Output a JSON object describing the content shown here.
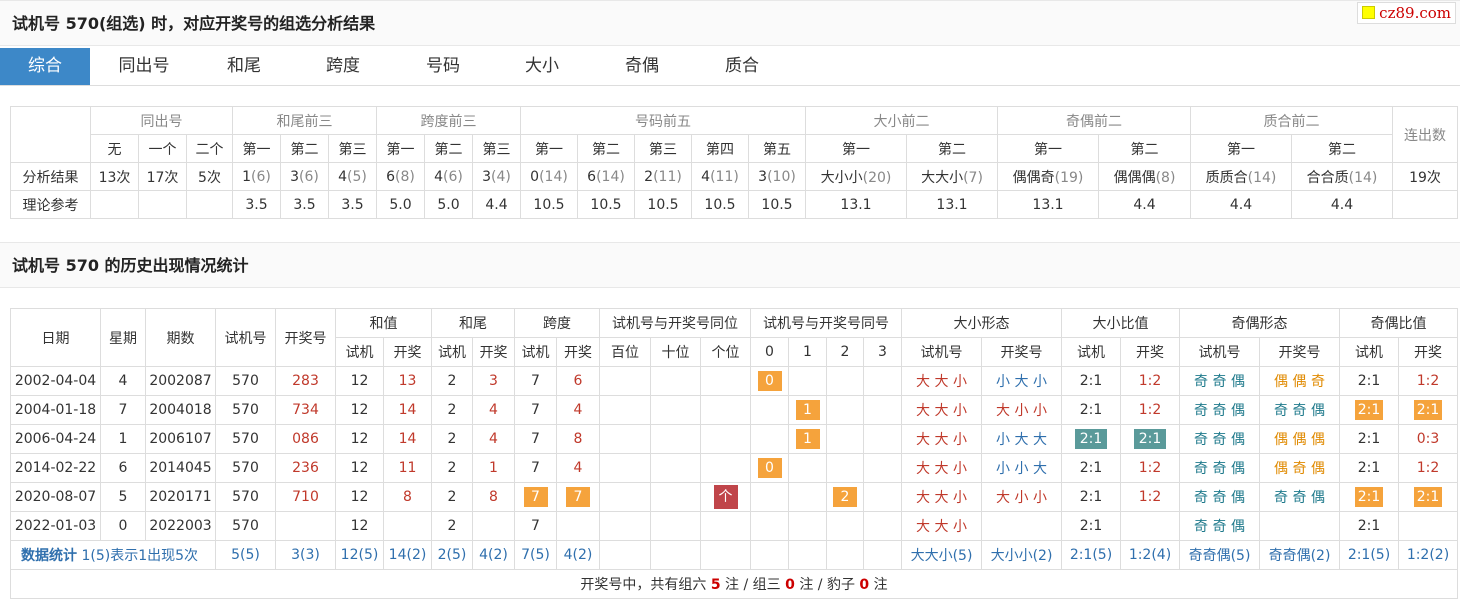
{
  "title1": "试机号 570(组选) 时，对应开奖号的组选分析结果",
  "logo": "cz89.com",
  "tabs": [
    "综合",
    "同出号",
    "和尾",
    "跨度",
    "号码",
    "大小",
    "奇偶",
    "质合"
  ],
  "title2": "试机号 570 的历史出现情况统计",
  "summary": {
    "groups": [
      "同出号",
      "和尾前三",
      "跨度前三",
      "号码前五",
      "大小前二",
      "奇偶前二",
      "质合前二",
      "连出数"
    ],
    "sub_tongchu": [
      "无",
      "一个",
      "二个"
    ],
    "sub3": [
      "第一",
      "第二",
      "第三"
    ],
    "sub5": [
      "第一",
      "第二",
      "第三",
      "第四",
      "第五"
    ],
    "sub2": [
      "第一",
      "第二"
    ],
    "row1_label": "分析结果",
    "row2_label": "理论参考",
    "tongchu_res": [
      "13次",
      "17次",
      "5次"
    ],
    "hewei_res": [
      [
        "1",
        "(6)"
      ],
      [
        "3",
        "(6)"
      ],
      [
        "4",
        "(5)"
      ]
    ],
    "kuadu_res": [
      [
        "6",
        "(8)"
      ],
      [
        "4",
        "(6)"
      ],
      [
        "3",
        "(4)"
      ]
    ],
    "haoma_res": [
      [
        "0",
        "(14)"
      ],
      [
        "6",
        "(14)"
      ],
      [
        "2",
        "(11)"
      ],
      [
        "4",
        "(11)"
      ],
      [
        "3",
        "(10)"
      ]
    ],
    "daxiao_res": [
      [
        "大小小",
        "(20)"
      ],
      [
        "大大小",
        "(7)"
      ]
    ],
    "jiou_res": [
      [
        "偶偶奇",
        "(19)"
      ],
      [
        "偶偶偶",
        "(8)"
      ]
    ],
    "zhihe_res": [
      [
        "质质合",
        "(14)"
      ],
      [
        "合合质",
        "(14)"
      ]
    ],
    "lianchu_res": "19次",
    "ref": [
      "3.5",
      "3.5",
      "3.5",
      "5.0",
      "5.0",
      "4.4",
      "10.5",
      "10.5",
      "10.5",
      "10.5",
      "10.5",
      "13.1",
      "13.1",
      "13.1",
      "4.4",
      "4.4",
      "4.4"
    ]
  },
  "history": {
    "headers": {
      "date": "日期",
      "week": "星期",
      "issue": "期数",
      "trial": "试机号",
      "draw": "开奖号",
      "hezhi": "和值",
      "hewei": "和尾",
      "kuadu": "跨度",
      "tongwei": "试机号与开奖号同位",
      "tonghao": "试机号与开奖号同号",
      "dxxt": "大小形态",
      "dxbz": "大小比值",
      "joxt": "奇偶形态",
      "jobz": "奇偶比值",
      "shiji": "试机",
      "kaijiang": "开奖",
      "shijihao": "试机号",
      "kaijianghao": "开奖号",
      "bai": "百位",
      "shi": "十位",
      "ge": "个位",
      "n0": "0",
      "n1": "1",
      "n2": "2",
      "n3": "3"
    },
    "rows": [
      {
        "date": "2002-04-04",
        "week": "4",
        "issue": "2002087",
        "trial": "570",
        "draw": "283",
        "hz_s": "12",
        "hz_k": "13",
        "hw_s": "2",
        "hw_k": "3",
        "kd_s": "7",
        "kd_k": "6",
        "kd_s_hl": false,
        "kd_k_hl": false,
        "tw": [
          "",
          "",
          ""
        ],
        "th": [
          "0",
          "",
          "",
          ""
        ],
        "dx_s": "大 大 小",
        "dx_k": "小 大 小",
        "dx_k_col": "blue",
        "dxb_s": "2:1",
        "dxb_k": "1:2",
        "dxb_hl": false,
        "jo_s": "奇 奇 偶",
        "jo_k": "偶 偶 奇",
        "jo_k_col": "orange",
        "job_s": "2:1",
        "job_k": "1:2",
        "job_hl": false
      },
      {
        "date": "2004-01-18",
        "week": "7",
        "issue": "2004018",
        "trial": "570",
        "draw": "734",
        "hz_s": "12",
        "hz_k": "14",
        "hw_s": "2",
        "hw_k": "4",
        "kd_s": "7",
        "kd_k": "4",
        "kd_s_hl": false,
        "kd_k_hl": false,
        "tw": [
          "",
          "",
          ""
        ],
        "th": [
          "",
          "1",
          "",
          ""
        ],
        "dx_s": "大 大 小",
        "dx_k": "大 小 小",
        "dx_k_col": "red",
        "dxb_s": "2:1",
        "dxb_k": "1:2",
        "dxb_hl": false,
        "jo_s": "奇 奇 偶",
        "jo_k": "奇 奇 偶",
        "jo_k_col": "teal",
        "job_s": "2:1",
        "job_k": "2:1",
        "job_hl": true
      },
      {
        "date": "2006-04-24",
        "week": "1",
        "issue": "2006107",
        "trial": "570",
        "draw": "086",
        "hz_s": "12",
        "hz_k": "14",
        "hw_s": "2",
        "hw_k": "4",
        "kd_s": "7",
        "kd_k": "8",
        "kd_s_hl": false,
        "kd_k_hl": false,
        "tw": [
          "",
          "",
          ""
        ],
        "th": [
          "",
          "1",
          "",
          ""
        ],
        "dx_s": "大 大 小",
        "dx_k": "小 大 大",
        "dx_k_col": "blue",
        "dxb_s": "2:1",
        "dxb_k": "2:1",
        "dxb_hl": true,
        "jo_s": "奇 奇 偶",
        "jo_k": "偶 偶 偶",
        "jo_k_col": "orange",
        "job_s": "2:1",
        "job_k": "0:3",
        "job_hl": false
      },
      {
        "date": "2014-02-22",
        "week": "6",
        "issue": "2014045",
        "trial": "570",
        "draw": "236",
        "hz_s": "12",
        "hz_k": "11",
        "hw_s": "2",
        "hw_k": "1",
        "kd_s": "7",
        "kd_k": "4",
        "kd_s_hl": false,
        "kd_k_hl": false,
        "tw": [
          "",
          "",
          ""
        ],
        "th": [
          "0",
          "",
          "",
          ""
        ],
        "dx_s": "大 大 小",
        "dx_k": "小 小 大",
        "dx_k_col": "blue",
        "dxb_s": "2:1",
        "dxb_k": "1:2",
        "dxb_hl": false,
        "jo_s": "奇 奇 偶",
        "jo_k": "偶 奇 偶",
        "jo_k_col": "orange",
        "job_s": "2:1",
        "job_k": "1:2",
        "job_hl": false
      },
      {
        "date": "2020-08-07",
        "week": "5",
        "issue": "2020171",
        "trial": "570",
        "draw": "710",
        "hz_s": "12",
        "hz_k": "8",
        "hw_s": "2",
        "hw_k": "8",
        "kd_s": "7",
        "kd_k": "7",
        "kd_s_hl": true,
        "kd_k_hl": true,
        "tw": [
          "",
          "",
          "个"
        ],
        "th": [
          "",
          "",
          "2",
          ""
        ],
        "dx_s": "大 大 小",
        "dx_k": "大 小 小",
        "dx_k_col": "red",
        "dxb_s": "2:1",
        "dxb_k": "1:2",
        "dxb_hl": false,
        "jo_s": "奇 奇 偶",
        "jo_k": "奇 奇 偶",
        "jo_k_col": "teal",
        "job_s": "2:1",
        "job_k": "2:1",
        "job_hl": true
      },
      {
        "date": "2022-01-03",
        "week": "0",
        "issue": "2022003",
        "trial": "570",
        "draw": "",
        "hz_s": "12",
        "hz_k": "",
        "hw_s": "2",
        "hw_k": "",
        "kd_s": "7",
        "kd_k": "",
        "kd_s_hl": false,
        "kd_k_hl": false,
        "tw": [
          "",
          "",
          ""
        ],
        "th": [
          "",
          "",
          "",
          ""
        ],
        "dx_s": "大 大 小",
        "dx_k": "",
        "dx_k_col": "blue",
        "dxb_s": "2:1",
        "dxb_k": "",
        "dxb_hl": false,
        "jo_s": "奇 奇 偶",
        "jo_k": "",
        "jo_k_col": "teal",
        "job_s": "2:1",
        "job_k": "",
        "job_hl": false
      }
    ],
    "stats": {
      "label": "数据统计",
      "note": "1(5)表示1出现5次",
      "trial": "5(5)",
      "draw": "3(3)",
      "hz_s": "12(5)",
      "hz_k": "14(2)",
      "hw_s": "2(5)",
      "hw_k": "4(2)",
      "kd_s": "7(5)",
      "kd_k": "4(2)",
      "dx_s": "大大小(5)",
      "dx_k": "大小小(2)",
      "dxb_s": "2:1(5)",
      "dxb_k": "1:2(4)",
      "jo_s": "奇奇偶(5)",
      "jo_k": "奇奇偶(2)",
      "job_s": "2:1(5)",
      "job_k": "1:2(2)"
    },
    "footer": {
      "p1": "开奖号中，共有组六",
      "n1": "5",
      "p2": " 注 / 组三",
      "n2": "0",
      "p3": " 注 / 豹子",
      "n3": "0",
      "p4": " 注"
    }
  }
}
